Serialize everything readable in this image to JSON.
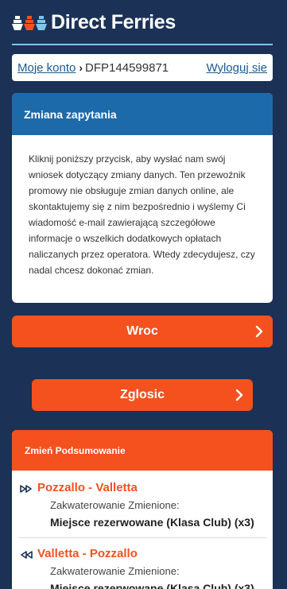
{
  "header": {
    "brand": "Direct Ferries",
    "logo_colors": [
      "#ffffff",
      "#f4511e",
      "#7fc4ea"
    ]
  },
  "account_bar": {
    "my_account_link": "Moje konto",
    "separator": "›",
    "booking_ref": "DFP144599871",
    "logout_link": "Wyloguj sie"
  },
  "request_card": {
    "title": "Zmiana zapytania",
    "body": "Kliknij poniższy przycisk, aby wysłać nam swój wniosek dotyczący zmiany danych. Ten przewoźnik promowy nie obsługuje zmian danych online, ale skontaktujemy się z nim bezpośrednio i wyślemy Ci wiadomość e-mail zawierającą szczegółowe informacje o wszelkich dodatkowych opłatach naliczanych przez operatora. Wtedy zdecydujesz, czy nadal chcesz dokonać zmian."
  },
  "buttons": {
    "back_label": "Wroc",
    "submit_label": "Zglosic"
  },
  "summary": {
    "title": "Zmień Podsumowanie",
    "routes": [
      {
        "direction": "outbound",
        "title": "Pozzallo - Valletta",
        "label": "Zakwaterowanie Zmienione:",
        "value": "Miejsce rezerwowane (Klasa Club) (x3)"
      },
      {
        "direction": "return",
        "title": "Valletta - Pozzallo",
        "label": "Zakwaterowanie Zmienione:",
        "value": "Miejsce rezerwowane (Klasa Club) (x3)"
      }
    ]
  },
  "colors": {
    "background": "#1b3156",
    "accent_orange": "#f4511e",
    "card_header_blue": "#1d6aaa",
    "link_blue": "#1c5b8f",
    "header_line": "#7fc4ea"
  }
}
